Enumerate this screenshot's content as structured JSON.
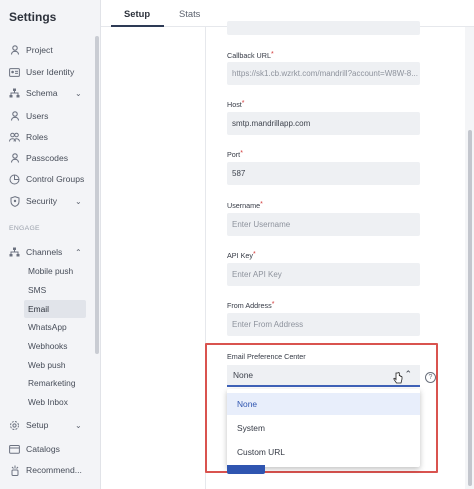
{
  "sidebar": {
    "title": "Settings",
    "items": [
      {
        "label": "Project",
        "icon": "project-icon"
      },
      {
        "label": "User Identity",
        "icon": "user-identity-icon"
      },
      {
        "label": "Schema",
        "icon": "schema-icon"
      },
      {
        "label": "Users",
        "icon": "users-icon"
      },
      {
        "label": "Roles",
        "icon": "roles-icon"
      },
      {
        "label": "Passcodes",
        "icon": "passcodes-icon"
      },
      {
        "label": "Control Groups",
        "icon": "control-groups-icon"
      },
      {
        "label": "Security",
        "icon": "security-icon"
      }
    ],
    "section_label": "ENGAGE",
    "channels_label": "Channels",
    "channel_items": [
      "Mobile push",
      "SMS",
      "Email",
      "WhatsApp",
      "Webhooks",
      "Web push",
      "Remarketing",
      "Web Inbox"
    ],
    "bottom_items": [
      {
        "label": "Setup",
        "icon": "setup-icon"
      },
      {
        "label": "Catalogs",
        "icon": "catalogs-icon"
      },
      {
        "label": "Recommend...",
        "icon": "recommend-icon"
      }
    ]
  },
  "tabs": {
    "setup": "Setup",
    "stats": "Stats"
  },
  "form": {
    "callback_url_label": "Callback URL",
    "callback_url_value": "https://sk1.cb.wzrkt.com/mandrill?account=W8W-8...",
    "host_label": "Host",
    "host_value": "smtp.mandrillapp.com",
    "port_label": "Port",
    "port_value": "587",
    "username_label": "Username",
    "username_placeholder": "Enter Username",
    "api_key_label": "API Key",
    "api_key_placeholder": "Enter API Key",
    "from_address_label": "From Address",
    "from_address_placeholder": "Enter From Address",
    "required_mark": "*",
    "pref_center_label": "Email Preference Center",
    "pref_center_value": "None",
    "pref_options": [
      "None",
      "System",
      "Custom URL"
    ],
    "help_glyph": "?"
  },
  "colors": {
    "accent": "#2f55b0",
    "highlight": "#d9534f",
    "required": "#d23a3a"
  }
}
